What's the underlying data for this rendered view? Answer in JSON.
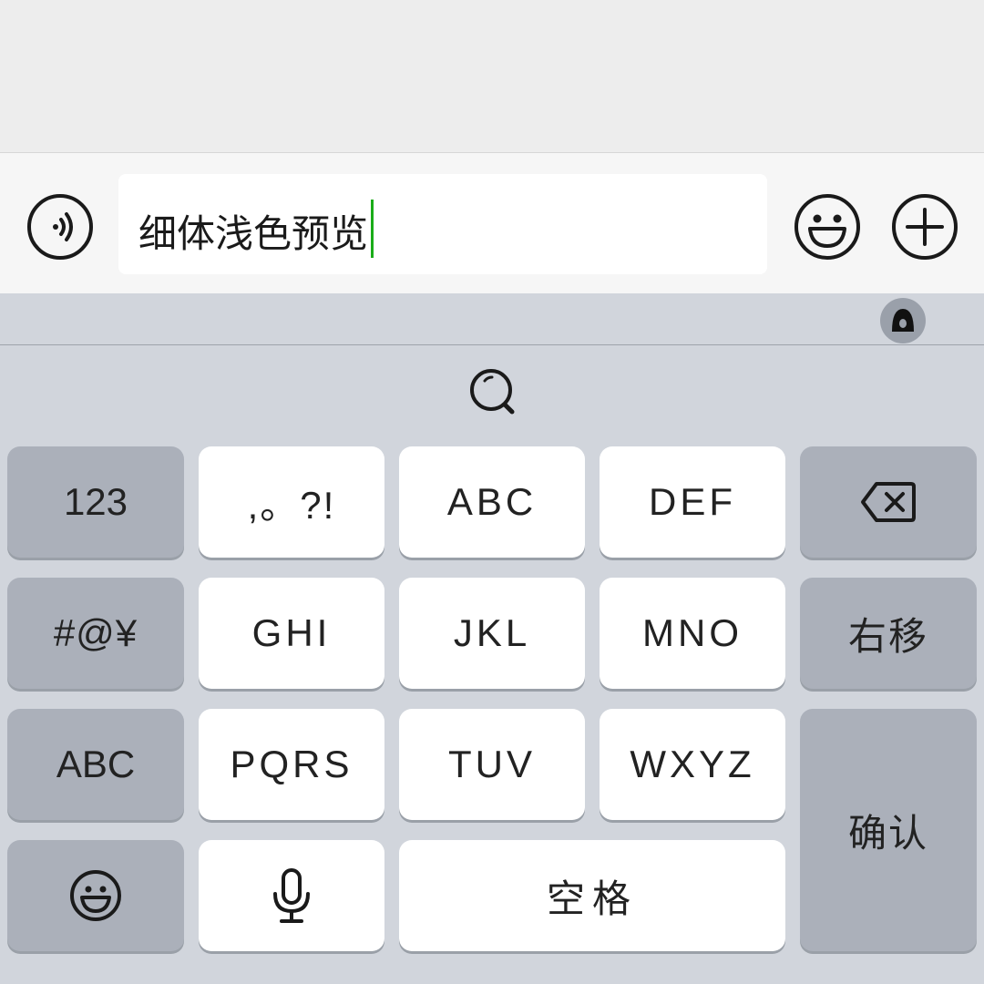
{
  "input": {
    "text": "细体浅色预览"
  },
  "icons": {
    "voice": "voice-input-icon",
    "emoji": "emoji-icon",
    "more": "plus-circle-icon",
    "ime": "ime-logo-icon",
    "search": "search-icon",
    "backspace": "backspace-icon",
    "keyboard_emoji": "emoji-face-icon",
    "mic": "microphone-icon"
  },
  "keyboard": {
    "row1": {
      "numbers": "123",
      "k1": ",。?!",
      "k2": "ABC",
      "k3": "DEF"
    },
    "row2": {
      "symbols": "#@¥",
      "k4": "GHI",
      "k5": "JKL",
      "k6": "MNO",
      "right_move": "右移"
    },
    "row3": {
      "abc": "ABC",
      "k7": "PQRS",
      "k8": "TUV",
      "k9": "WXYZ",
      "confirm": "确认"
    },
    "row4": {
      "space": "空格"
    }
  },
  "colors": {
    "cursor": "#1aad19",
    "keyboard_bg": "#d1d5dc",
    "function_key": "#abb0ba",
    "char_key": "#ffffff"
  }
}
